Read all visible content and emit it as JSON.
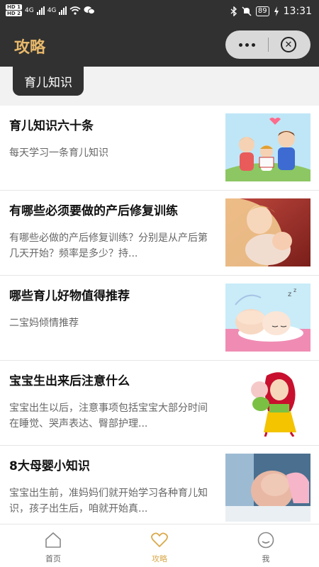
{
  "status_bar": {
    "hd1": "HD 1",
    "hd2": "HD 2",
    "net1": "4G",
    "net2": "4G",
    "battery": "89",
    "time": "13:31"
  },
  "header": {
    "title": "攻略",
    "more_icon": "more-dots-icon",
    "close_icon": "close-circle-icon"
  },
  "category": {
    "active_tab": "育儿知识"
  },
  "articles": [
    {
      "title": "育儿知识六十条",
      "desc": "每天学习一条育儿知识",
      "image": "family-illustration"
    },
    {
      "title": "有哪些必须要做的产后修复训练",
      "desc": "有哪些必做的产后修复训练？分别是从产后第几天开始？频率是多少？持...",
      "image": "mother-baby-photo"
    },
    {
      "title": "哪些育儿好物值得推荐",
      "desc": "二宝妈倾情推荐",
      "image": "sleeping-baby-illustration"
    },
    {
      "title": "宝宝生出来后注意什么",
      "desc": "宝宝出生以后，注意事项包括宝宝大部分时间在睡觉、哭声表达、臀部护理...",
      "image": "mother-holding-baby-illustration"
    },
    {
      "title": "8大母婴小知识",
      "desc": "宝宝出生前，准妈妈们就开始学习各种育儿知识，孩子出生后，咱就开始真...",
      "image": "newborn-photo"
    }
  ],
  "bottom_nav": [
    {
      "label": "首页",
      "icon": "home-icon",
      "active": false
    },
    {
      "label": "攻略",
      "icon": "heart-icon",
      "active": true
    },
    {
      "label": "我",
      "icon": "smile-icon",
      "active": false
    }
  ],
  "colors": {
    "header_bg": "#313131",
    "accent": "#e8b96a",
    "nav_active": "#d9a94b"
  }
}
